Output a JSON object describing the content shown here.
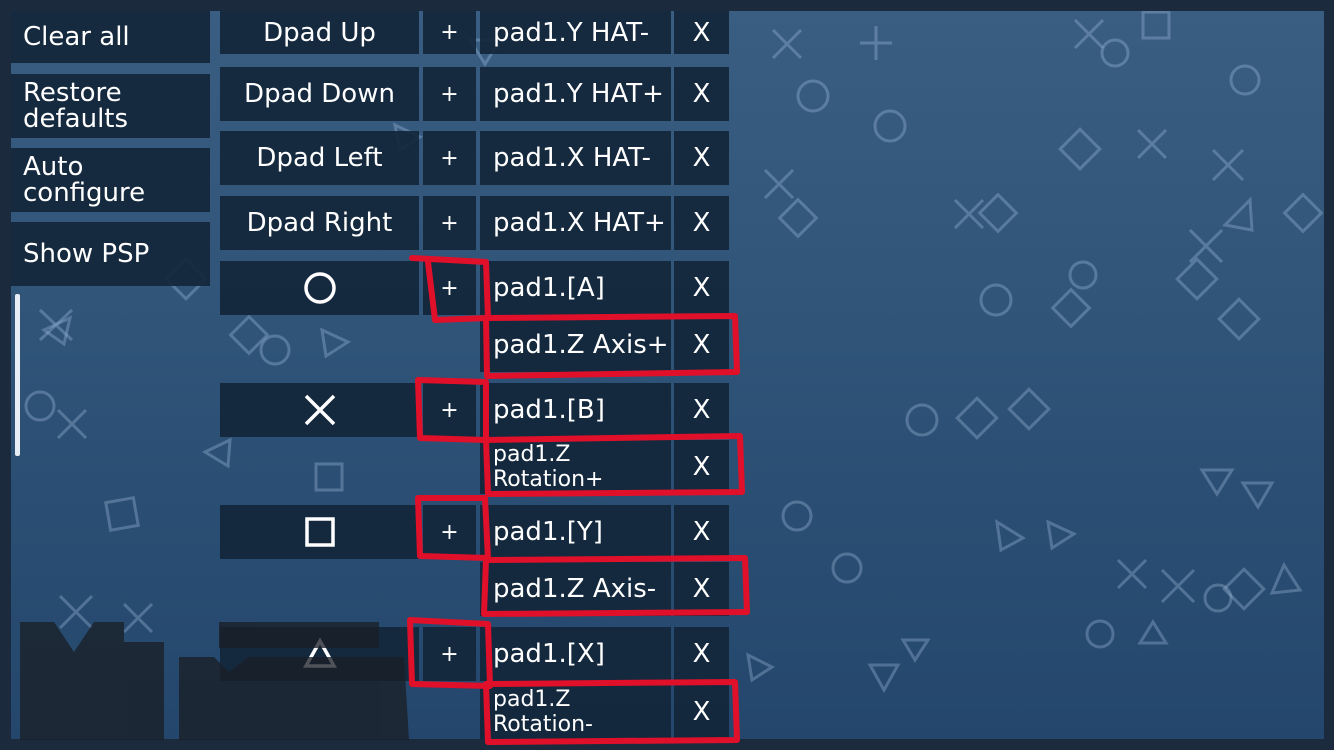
{
  "sidebar": {
    "clear_all": "Clear all",
    "restore_defaults": "Restore defaults",
    "auto_configure": "Auto configure",
    "show_psp": "Show PSP"
  },
  "mappings": {
    "dpad_up": {
      "key": "Dpad Up",
      "plus": "+",
      "binding": "pad1.Y HAT-",
      "delete": "X"
    },
    "dpad_down": {
      "key": "Dpad Down",
      "plus": "+",
      "binding": "pad1.Y HAT+",
      "delete": "X"
    },
    "dpad_left": {
      "key": "Dpad Left",
      "plus": "+",
      "binding": "pad1.X HAT-",
      "delete": "X"
    },
    "dpad_right": {
      "key": "Dpad Right",
      "plus": "+",
      "binding": "pad1.X HAT+",
      "delete": "X"
    },
    "circle": {
      "key_icon": "circle-icon",
      "plus": "+",
      "binding": "pad1.[A]",
      "binding2": "pad1.Z Axis+",
      "delete": "X"
    },
    "cross": {
      "key_icon": "cross-icon",
      "plus": "+",
      "binding": "pad1.[B]",
      "binding2": "pad1.Z Rotation+",
      "delete": "X"
    },
    "square": {
      "key_icon": "square-icon",
      "plus": "+",
      "binding": "pad1.[Y]",
      "binding2": "pad1.Z Axis-",
      "delete": "X"
    },
    "triangle": {
      "key_icon": "triangle-icon",
      "plus": "+",
      "binding": "pad1.[X]",
      "binding2": "pad1.Z Rotation-",
      "delete": "X"
    }
  },
  "colors": {
    "background": "#2f5478",
    "button_bg": "#12263a",
    "annotation": "#e0102a"
  }
}
